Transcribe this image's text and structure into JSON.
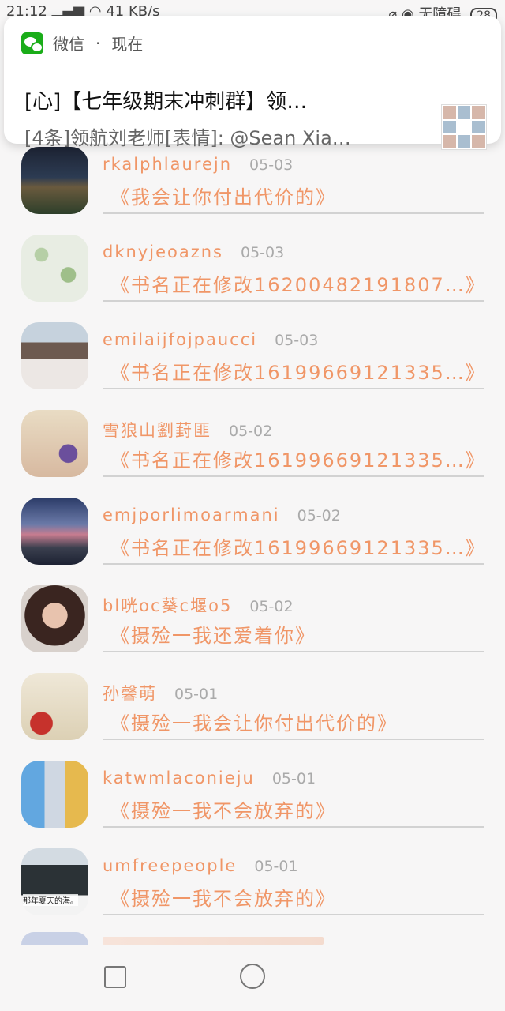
{
  "status_bar": {
    "time": "21:12",
    "network": "41 KB/s",
    "mode": "无障碍",
    "battery": "28"
  },
  "notification": {
    "app_name": "微信",
    "separator": "·",
    "when": "现在",
    "title": "[心]【七年级期末冲刺群】领…",
    "body": "[4条]领航刘老师[表情]: @Sean Xia…",
    "icon": "wechat-icon"
  },
  "list": [
    {
      "name": "rkalphlaurejn",
      "date": "05-03",
      "message": "《我会让你付出代价的》"
    },
    {
      "name": "dknyjeoazns",
      "date": "05-03",
      "message": "《书名正在修改16200482191807…》"
    },
    {
      "name": "emilaijfojpaucci",
      "date": "05-03",
      "message": "《书名正在修改16199669121335…》"
    },
    {
      "name": "雪狼山劉葑匪",
      "date": "05-02",
      "message": "《书名正在修改16199669121335…》"
    },
    {
      "name": "emjporlimoarmani",
      "date": "05-02",
      "message": "《书名正在修改16199669121335…》"
    },
    {
      "name": "bl咣oc葵c堰o5",
      "date": "05-02",
      "message": "《摄殓一我还爱着你》"
    },
    {
      "name": "孙馨萌",
      "date": "05-01",
      "message": "《摄殓一我会让你付出代价的》"
    },
    {
      "name": "katwmlaconieju",
      "date": "05-01",
      "message": "《摄殓一我不会放弃的》"
    },
    {
      "name": "umfreepeople",
      "date": "05-01",
      "message": "《摄殓一我不会放弃的》",
      "avatar_caption": "那年夏天的海。"
    }
  ],
  "nav": {
    "recents": "square-icon",
    "home": "circle-icon",
    "back": "triangle-back-icon"
  }
}
